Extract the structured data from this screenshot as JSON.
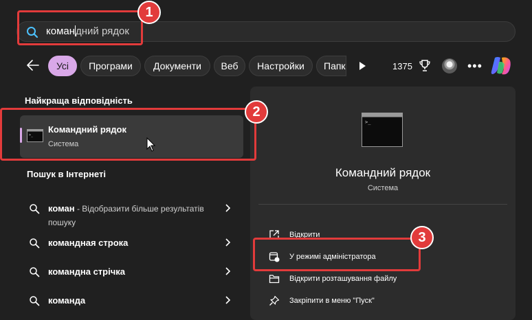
{
  "search": {
    "typed": "коман",
    "suggested": "дний рядок"
  },
  "filters": {
    "chips": [
      "Усі",
      "Програми",
      "Документи",
      "Веб",
      "Настройки",
      "Папк"
    ],
    "points": "1375"
  },
  "best_match": {
    "title": "Найкраща відповідність",
    "name": "Командний рядок",
    "subtitle": "Система"
  },
  "web_search": {
    "title": "Пошук в Інтернеті",
    "items": [
      {
        "query": "коман",
        "desc": " - Відобразити більше результатів пошуку"
      },
      {
        "query": "командная строка",
        "desc": ""
      },
      {
        "query": "командна стрічка",
        "desc": ""
      },
      {
        "query": "команда",
        "desc": ""
      }
    ]
  },
  "preview": {
    "name": "Командний рядок",
    "subtitle": "Система",
    "actions": [
      {
        "label": "Відкрити",
        "icon": "open-external-icon"
      },
      {
        "label": "У режимі адміністратора",
        "icon": "run-as-admin-icon"
      },
      {
        "label": "Відкрити розташування файлу",
        "icon": "folder-icon"
      },
      {
        "label": "Закріпити в меню \"Пуск\"",
        "icon": "pin-icon"
      }
    ]
  },
  "annotations": {
    "badges": [
      "1",
      "2",
      "3"
    ],
    "color": "#e23b3b"
  },
  "colors": {
    "accent": "#d9a8e8",
    "background": "#202020",
    "pane": "#2c2c2c"
  }
}
